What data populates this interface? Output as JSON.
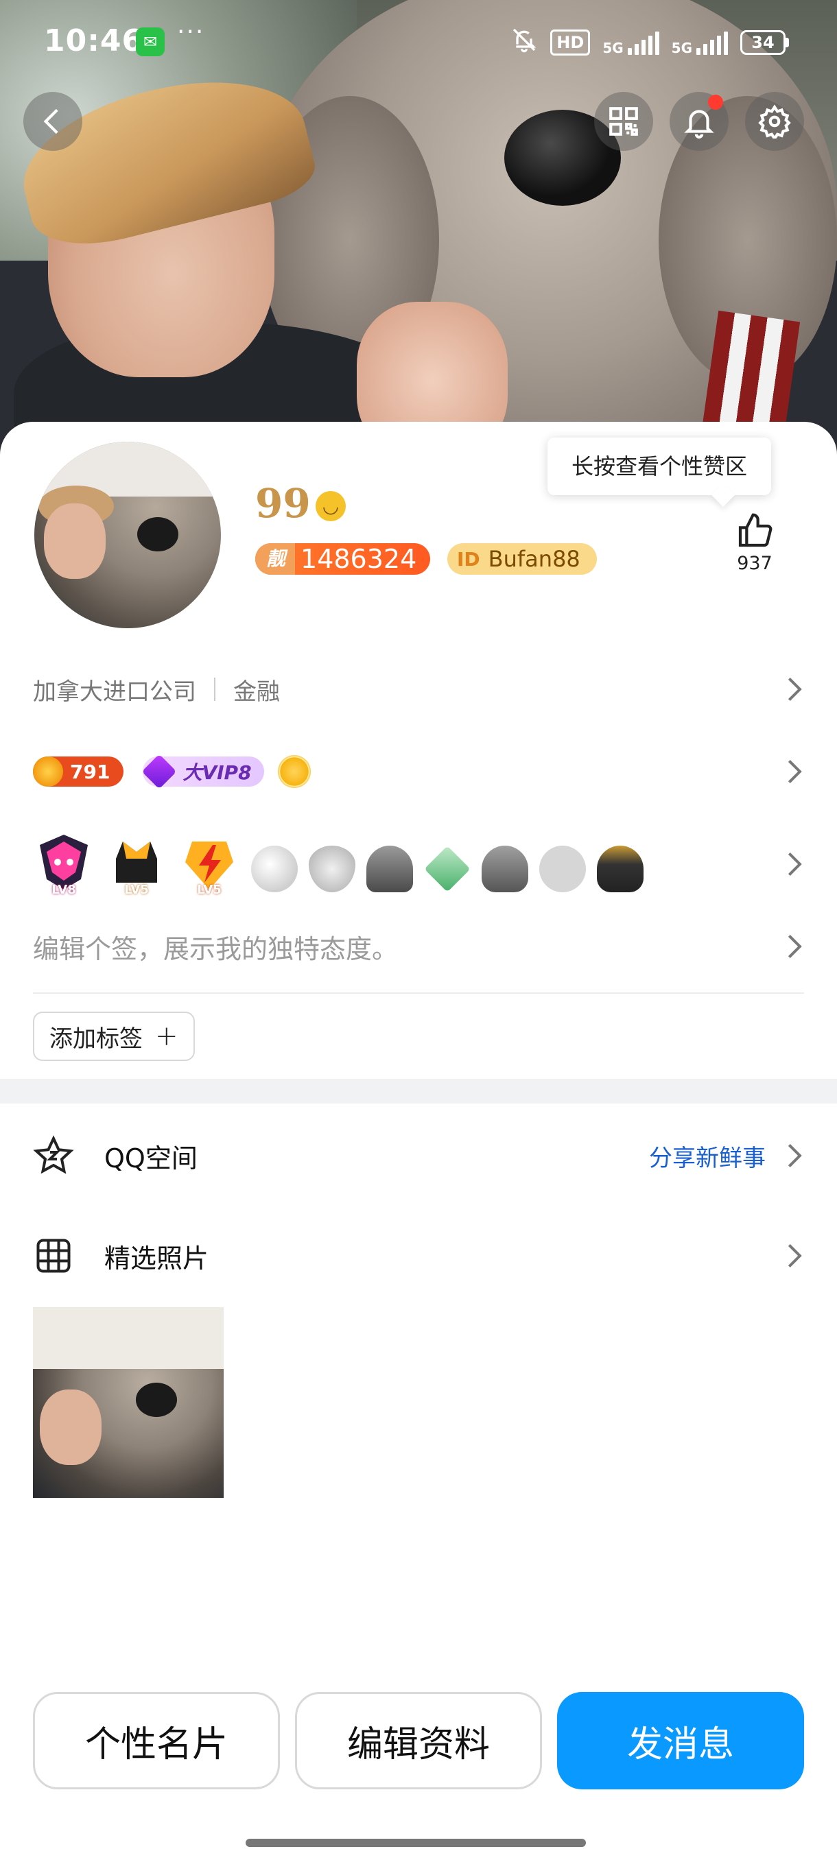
{
  "status_bar": {
    "time": "10:46",
    "more": "···",
    "hd": "HD",
    "net1": "5G",
    "net2": "5G",
    "battery": "34"
  },
  "profile": {
    "nickname": "99",
    "qq_tag": "靓",
    "qq_number": "1486324",
    "id_tag": "ID",
    "id_value": "Bufan88",
    "like_tooltip": "长按查看个性赞区",
    "like_count": "937",
    "company": "加拿大进口公司",
    "industry": "金融",
    "level_value": "791",
    "vip_label": "大VIP8",
    "medal_captions": [
      "LV8",
      "LV5",
      "LV5"
    ],
    "bio_placeholder": "编辑个签，展示我的独特态度。",
    "add_tag_label": "添加标签",
    "add_tag_plus": "+"
  },
  "sections": {
    "qzone_label": "QQ空间",
    "qzone_link": "分享新鲜事",
    "photos_label": "精选照片"
  },
  "actions": {
    "card_label": "个性名片",
    "edit_label": "编辑资料",
    "message_label": "发消息"
  },
  "colors": {
    "primary": "#0a99ff",
    "nickname": "#c9954a",
    "qq_badge": "#ff5a22",
    "link": "#1a5fd0"
  },
  "icons": [
    "back-icon",
    "qr-code-icon",
    "bell-icon",
    "settings-icon",
    "thumbs-up-icon",
    "qzone-star-icon",
    "grid-icon",
    "chevron-right-icon"
  ]
}
